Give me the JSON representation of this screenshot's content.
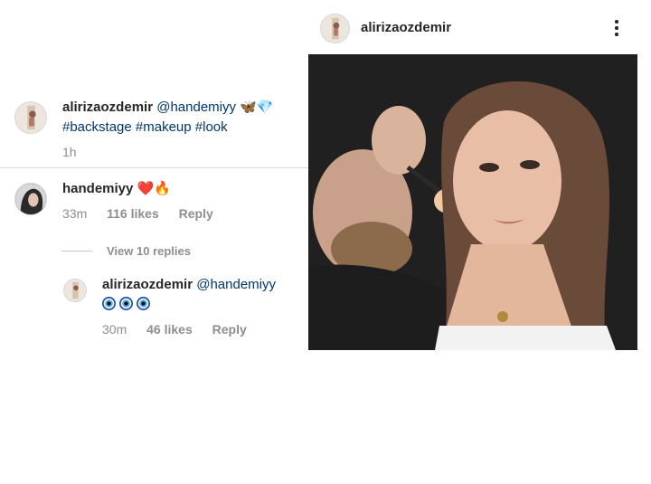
{
  "caption": {
    "username": "alirizaozdemir",
    "mention": "@handemiyy",
    "emojis": "🦋💎",
    "hashtags": "#backstage #makeup #look",
    "time": "1h"
  },
  "comments": [
    {
      "username": "handemiyy",
      "emojis": "❤️🔥",
      "time": "33m",
      "likes": "116 likes",
      "reply": "Reply"
    }
  ],
  "view_replies": "View 10 replies",
  "replies": [
    {
      "username": "alirizaozdemir",
      "mention": "@handemiyy",
      "emojis": "🧿🧿🧿",
      "time": "30m",
      "likes": "46 likes",
      "reply": "Reply"
    }
  ],
  "post": {
    "username": "alirizaozdemir",
    "more_icon": "more-vertical-icon"
  }
}
